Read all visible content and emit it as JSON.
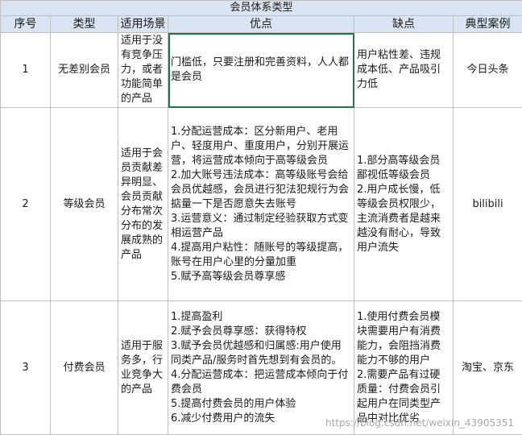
{
  "table": {
    "title": "会员体系类型",
    "headers": [
      "序号",
      "类型",
      "适用场景",
      "优点",
      "缺点",
      "典型案例"
    ],
    "rows": [
      {
        "no": "1",
        "type": "无差别会员",
        "scene": "适用于没有竞争压力，或者功能简单的产品",
        "pros": "门槛低，只要注册和完善资料，人人都是会员",
        "cons": "用户粘性差、违规成本低、产品吸引力低",
        "case": "今日头条"
      },
      {
        "no": "2",
        "type": "等级会员",
        "scene": "适用于会员贡献差异明显、会员贡献分布常次分布的发展成熟的产品",
        "pros": "1.分配运营成本：区分新用户、老用户、轻度用户、重度用户，分别开展运营，将运营成本倾向于高等级会员\n2.加大账号违法成本：高等级账号会给会员优越感，会员进行犯法犯规行为会掂量一下是否愿意失去账号\n3.运营意义：通过制定经验获取方式变相运营产品\n4.提高用户粘性：随账号的等级提高，账号在用户心里的分量加重\n5.赋予高等级会员尊享感",
        "cons": "1.部分高等级会员鄙视低等级会员\n2.用户成长慢，低等级会员权限少，主流消费者是越来越没有耐心，导致用户流失",
        "case": "bilibili"
      },
      {
        "no": "3",
        "type": "付费会员",
        "scene": "适用于服务多，行业竞争大的产品",
        "pros": "1.提高盈利\n2.赋予会员尊享感：获得特权\n3.赋予会员优越感和归属感:用户使用同类产品/服务时首先想到有会员的。\n4.分配运营成本：把运营成本倾向于付费会员\n5.提高付费会员的用户体验\n6.减少付费用户的流失",
        "cons": "1.使用付费会员模块需要用户有消费能力，会阻挡消费能力不够的用户\n2.需要产品有过硬质量：付费会员引起用户在同类型产品中对比优劣",
        "case": "淘宝、京东"
      }
    ]
  },
  "watermark": "https://blog.csdn.net/weixin_43905351"
}
